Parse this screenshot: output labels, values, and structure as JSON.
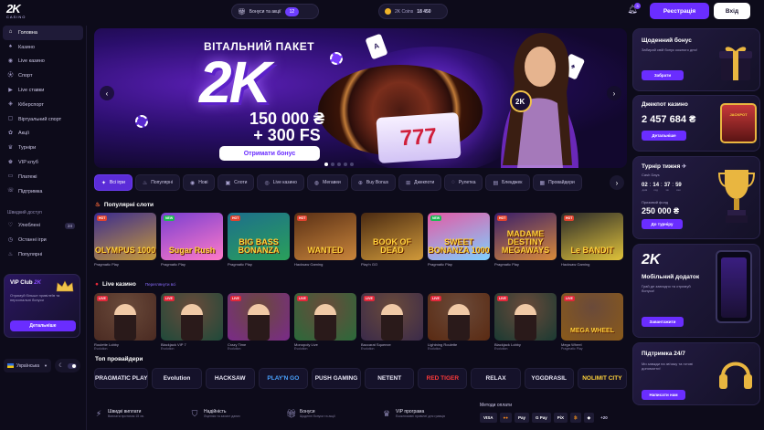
{
  "header": {
    "logo_main": "2K",
    "logo_sub": "CASINO",
    "bonuses_label": "Бонуси та акції",
    "bonuses_count": "12",
    "coins_label": "2K Coins",
    "coins_value": "18 450",
    "notifications_count": "3",
    "register_label": "Реєстрація",
    "login_label": "Вхід"
  },
  "sidebar": {
    "items": [
      {
        "label": "Головна",
        "icon": "home-icon"
      },
      {
        "label": "Казино",
        "icon": "casino-icon"
      },
      {
        "label": "Live казино",
        "icon": "live-icon"
      },
      {
        "label": "Спорт",
        "icon": "sport-icon"
      },
      {
        "label": "Live ставки",
        "icon": "live-bets-icon"
      },
      {
        "label": "Кіберспорт",
        "icon": "esports-icon"
      },
      {
        "label": "Віртуальний спорт",
        "icon": "virtual-icon"
      },
      {
        "label": "Акції",
        "icon": "gift-icon"
      },
      {
        "label": "Турніри",
        "icon": "trophy-icon"
      },
      {
        "label": "VIP клуб",
        "icon": "crown-icon"
      },
      {
        "label": "Платежі",
        "icon": "wallet-icon"
      },
      {
        "label": "Підтримка",
        "icon": "support-icon"
      }
    ],
    "quick_access_title": "Швидкий доступ",
    "quick": [
      {
        "label": "Улюблені",
        "icon": "heart-icon",
        "badge": "24"
      },
      {
        "label": "Останні ігри",
        "icon": "clock-icon",
        "badge": ""
      },
      {
        "label": "Популярні",
        "icon": "fire-icon",
        "badge": ""
      }
    ],
    "vip": {
      "title": "VIP Club",
      "title_brand": "2K",
      "desc": "Отримуй більше привілеїв та персональні бонуси",
      "button": "Детальніше"
    },
    "language": "Українська"
  },
  "hero": {
    "subtitle": "ВІТАЛЬНИЙ ПАКЕТ",
    "big": "2K",
    "amount": "150 000 ₴",
    "fs": "+ 300 FS",
    "button": "Отримати бонус",
    "slot_text": "777",
    "slide_count": 5,
    "active_slide": 0
  },
  "categories": [
    {
      "label": "Всі ігри",
      "icon": "✦",
      "active": true
    },
    {
      "label": "Популярні",
      "icon": "♨",
      "active": false
    },
    {
      "label": "Нові",
      "icon": "◉",
      "active": false
    },
    {
      "label": "Слоти",
      "icon": "▣",
      "active": false
    },
    {
      "label": "Live казино",
      "icon": "◎",
      "active": false
    },
    {
      "label": "Мегавеи",
      "icon": "◍",
      "active": false
    },
    {
      "label": "Buy Bonus",
      "icon": "⊕",
      "active": false
    },
    {
      "label": "Джекпоти",
      "icon": "⊞",
      "active": false
    },
    {
      "label": "Рулетка",
      "icon": "◌",
      "active": false
    },
    {
      "label": "Блекджек",
      "icon": "▤",
      "active": false
    },
    {
      "label": "Провайдери",
      "icon": "▦",
      "active": false
    }
  ],
  "popular": {
    "title": "Популярні слоти",
    "games": [
      {
        "tag": "HOT",
        "name": "OLYMPUS 1000",
        "provider": "Pragmatic Play",
        "bg": "#3b2c8f",
        "bg2": "#c79a3a"
      },
      {
        "tag": "NEW",
        "name": "Sugar Rush",
        "provider": "Pragmatic Play",
        "bg": "#7a3fd1",
        "bg2": "#ff7ac8"
      },
      {
        "tag": "HOT",
        "name": "BIG BASS BONANZA",
        "provider": "Pragmatic Play",
        "bg": "#1d6f8c",
        "bg2": "#2aa05a"
      },
      {
        "tag": "HOT",
        "name": "WANTED",
        "provider": "Hacksaw Gaming",
        "bg": "#5a3016",
        "bg2": "#c9853b"
      },
      {
        "tag": "",
        "name": "BOOK OF DEAD",
        "provider": "Play'n GO",
        "bg": "#4a2a12",
        "bg2": "#d19a3a"
      },
      {
        "tag": "NEW",
        "name": "SWEET BONANZA 1000",
        "provider": "Pragmatic Play",
        "bg": "#e35aa5",
        "bg2": "#7fd0ff"
      },
      {
        "tag": "HOT",
        "name": "MADAME DESTINY MEGAWAYS",
        "provider": "Pragmatic Play",
        "bg": "#3a1f6a",
        "bg2": "#d98a3a"
      },
      {
        "tag": "HOT",
        "name": "Le BANDIT",
        "provider": "Hacksaw Gaming",
        "bg": "#2a2a2a",
        "bg2": "#e0c23a"
      }
    ]
  },
  "live": {
    "title": "Live казино",
    "link": "Переглянути всі",
    "games": [
      {
        "name": "Roulette Lobby",
        "provider": "Evolution",
        "bg": "#4a2a22"
      },
      {
        "name": "Blackjack VIP 7",
        "provider": "Evolution",
        "bg": "#1e4a3a"
      },
      {
        "name": "Crazy Time",
        "provider": "Evolution",
        "bg": "#7a2a8a"
      },
      {
        "name": "Monopoly Live",
        "provider": "Evolution",
        "bg": "#2a6a3a"
      },
      {
        "name": "Baccarat Squeeze",
        "provider": "Evolution",
        "bg": "#3a2a4a"
      },
      {
        "name": "Lightning Roulette",
        "provider": "Evolution",
        "bg": "#5a2a12"
      },
      {
        "name": "Blackjack Lobby",
        "provider": "Evolution",
        "bg": "#1a3a32"
      },
      {
        "name": "Mega Wheel",
        "provider": "Pragmatic Play",
        "bg": "#8a5a1a",
        "label": "MEGA WHEEL"
      }
    ]
  },
  "providers": {
    "title": "Топ провайдери",
    "items": [
      "PRAGMATIC PLAY",
      "Evolution",
      "HACKSAW",
      "PLAY'N GO",
      "PUSH GAMING",
      "NETENT",
      "RED TIGER",
      "RELAX",
      "YGGDRASIL",
      "NOLIMIT CITY"
    ]
  },
  "features": [
    {
      "title": "Швидкі виплати",
      "desc": "Виплати протягом 15 хв.",
      "icon": "lightning-icon"
    },
    {
      "title": "Надійність",
      "desc": "Ліцензія та захист даних",
      "icon": "shield-icon"
    },
    {
      "title": "Бонуси",
      "desc": "Щоденні бонуси та акції",
      "icon": "gift-icon"
    },
    {
      "title": "VIP програма",
      "desc": "Ексклюзивні привілеї для гравців",
      "icon": "crown-icon"
    }
  ],
  "payments": {
    "title": "Методи оплати",
    "items": [
      "VISA",
      "●●",
      "Pay",
      "G Pay",
      "PiX",
      "₿",
      "◆",
      "+20"
    ]
  },
  "right": {
    "daily": {
      "title": "Щоденний бонус",
      "desc": "Забирай свій бонус кожного дня!",
      "button": "Забрати"
    },
    "jackpot": {
      "title": "Джекпот казино",
      "value": "2 457 684 ₴",
      "button": "Детальніше",
      "sign": "JACKPOT"
    },
    "tournament": {
      "title": "Турнір тижня",
      "subtitle": "Cash Days",
      "days": "02",
      "hours": "14",
      "minutes": "37",
      "seconds": "59",
      "l_days": "днів",
      "l_hours": "год",
      "l_minutes": "хв",
      "l_seconds": "сек",
      "prize_label": "Призовий фонд",
      "prize": "250 000 ₴",
      "button": "До турніру"
    },
    "app": {
      "brand": "2K",
      "title": "Мобільний додаток",
      "desc": "Грай де завгодно та отримуй бонуси!",
      "button": "Завантажити"
    },
    "support": {
      "title": "Підтримка 24/7",
      "desc": "Ми завжди на зв'язку та готові допомогти!",
      "button": "Написати нам"
    }
  }
}
